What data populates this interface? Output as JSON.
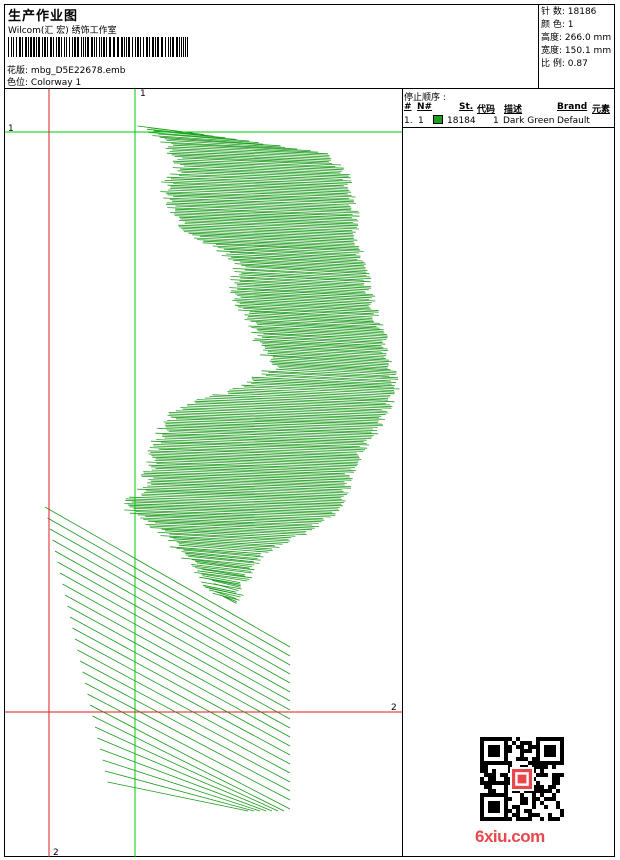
{
  "header": {
    "title": "生产作业图",
    "company": "Wilcom(汇 宏) 绣饰工作室",
    "design_label": "花版:",
    "design_value": "mbg_D5E22678.emb",
    "colorway_label": "色位:",
    "colorway_value": "Colorway 1"
  },
  "stats": [
    {
      "label": "针 数:",
      "value": "18186"
    },
    {
      "label": "颜 色:",
      "value": "1"
    },
    {
      "label": "高度:",
      "value": "266.0 mm"
    },
    {
      "label": "宽度:",
      "value": "150.1 mm"
    },
    {
      "label": "比 例:",
      "value": "0.87"
    }
  ],
  "stop_sequence": {
    "title": "停止顺序 :",
    "columns": [
      "#",
      "N#",
      "St.",
      "代码",
      "描述",
      "Brand",
      "元素"
    ],
    "rows": [
      {
        "num": "1.",
        "needle": "1",
        "color": "#1e9e1e",
        "stitches": "18184",
        "code": "1",
        "description": "Dark Green",
        "brand": "Default"
      }
    ]
  },
  "guides": {
    "v1": "1",
    "h1": "1",
    "h2": "2",
    "v2": "2"
  },
  "colors": {
    "embroidery_green": "#1a9a1a",
    "guide_green": "#00cc00",
    "guide_red": "#d81e1e",
    "logo_red": "#e8484b"
  },
  "watermark": {
    "logo_text": "6xiu.com",
    "qr_badge": "QR code with red seal"
  }
}
